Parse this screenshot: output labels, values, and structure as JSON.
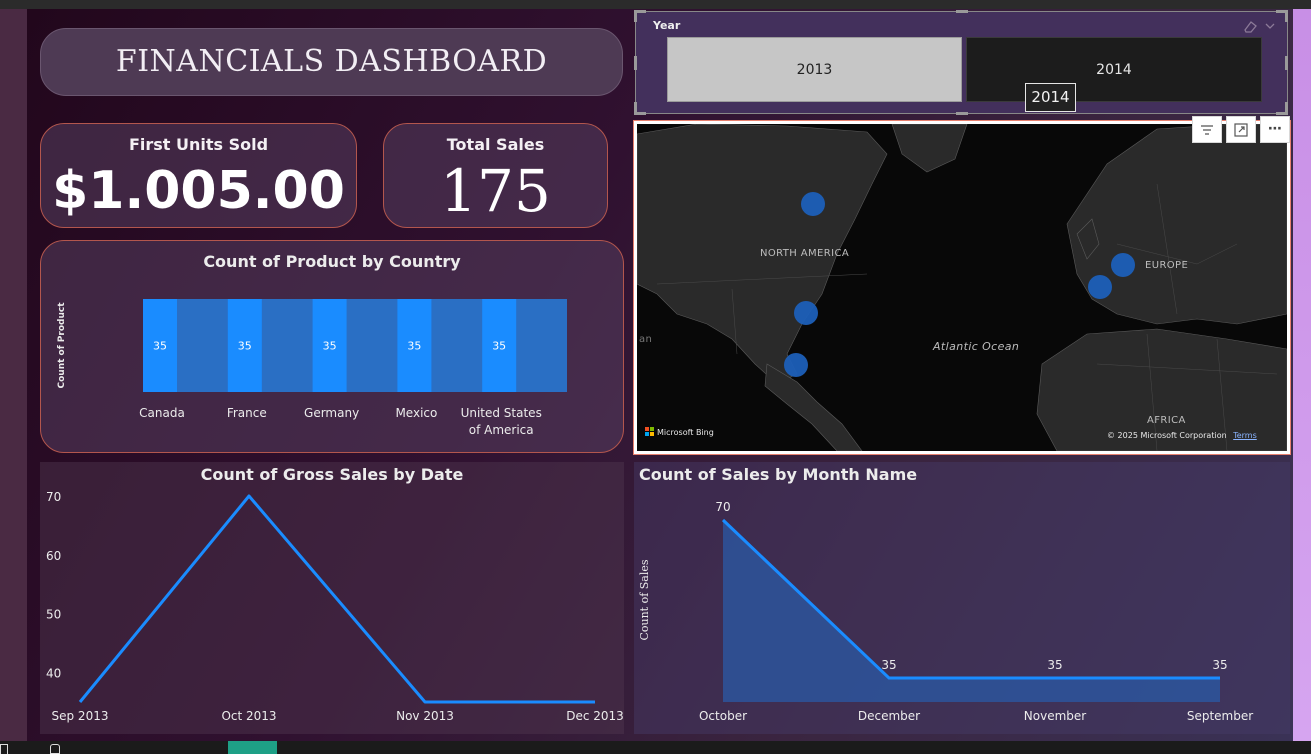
{
  "dashboard_title": "FINANCIALS DASHBOARD",
  "kpis": {
    "first_units_sold_label": "First Units Sold",
    "first_units_sold_value": "$1.005.00",
    "total_sales_label": "Total Sales",
    "total_sales_value": "175"
  },
  "year_slicer": {
    "label": "Year",
    "options": [
      "2013",
      "2014"
    ],
    "selected": "2013",
    "hover_tooltip": "2014"
  },
  "map": {
    "labels": {
      "north_america": "NORTH AMERICA",
      "europe": "EUROPE",
      "atlantic": "Atlantic Ocean",
      "africa": "AFRICA",
      "partial_left": "an"
    },
    "brand": "Microsoft Bing",
    "copyright": "© 2025 Microsoft Corporation",
    "terms": "Terms",
    "bubble_color": "#1c5fb8"
  },
  "colors": {
    "accent_blue": "#1a8cff",
    "bar_band": "#2a6fc4",
    "card_border": "#b3564d",
    "text_light": "#ececec"
  },
  "chart_data": [
    {
      "type": "bar",
      "title": "Count of Product by Country",
      "ylabel": "Count of Product",
      "xlabel": "",
      "categories": [
        "Canada",
        "France",
        "Germany",
        "Mexico",
        "United States of America"
      ],
      "values": [
        35,
        35,
        35,
        35,
        35
      ],
      "data_labels": [
        "35",
        "35",
        "35",
        "35",
        "35"
      ]
    },
    {
      "type": "line",
      "title": "Count of Gross Sales by Date",
      "x": [
        "Sep 2013",
        "Oct 2013",
        "Nov 2013",
        "Dec 2013"
      ],
      "values": [
        35,
        70,
        35,
        35
      ],
      "yticks": [
        "70",
        "60",
        "50",
        "40"
      ],
      "ylim": [
        35,
        70
      ]
    },
    {
      "type": "area",
      "title": "Count of Sales by Month Name",
      "ylabel": "Count of Sales",
      "categories": [
        "October",
        "December",
        "November",
        "September"
      ],
      "values": [
        70,
        35,
        35,
        35
      ],
      "data_labels": [
        "70",
        "35",
        "35",
        "35"
      ]
    }
  ]
}
